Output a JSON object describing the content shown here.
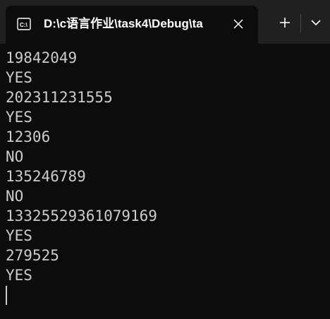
{
  "tab": {
    "title": "D:\\c语言作业\\task4\\Debug\\ta",
    "icon": "terminal-icon"
  },
  "toolbar": {
    "new_tab_icon": "plus-icon",
    "dropdown_icon": "chevron-down-icon",
    "close_icon": "close-icon"
  },
  "console": {
    "lines": [
      "19842049",
      "YES",
      "202311231555",
      "YES",
      "12306",
      "NO",
      "135246789",
      "NO",
      "13325529361079169",
      "YES",
      "279525",
      "YES"
    ]
  },
  "colors": {
    "titlebar_bg": "#202020",
    "console_bg": "#0c0c0c",
    "text": "#cccccc"
  }
}
